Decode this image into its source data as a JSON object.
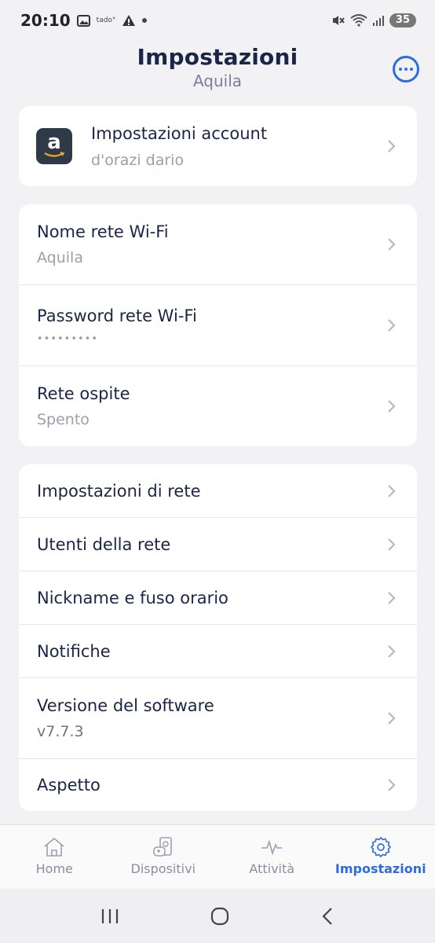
{
  "status_bar": {
    "time": "20:10",
    "small_icon_text": "tado°",
    "battery": "35"
  },
  "header": {
    "title": "Impostazioni",
    "subtitle": "Aquila"
  },
  "account": {
    "label": "Impostazioni account",
    "value": "d'orazi dario",
    "logo_letter": "a"
  },
  "wifi_section": [
    {
      "label": "Nome rete Wi-Fi",
      "value": "Aquila"
    },
    {
      "label": "Password rete Wi-Fi",
      "value": "•••••••••"
    },
    {
      "label": "Rete ospite",
      "value": "Spento"
    }
  ],
  "settings_section": [
    {
      "label": "Impostazioni di rete"
    },
    {
      "label": "Utenti della rete"
    },
    {
      "label": "Nickname e fuso orario"
    },
    {
      "label": "Notifiche"
    },
    {
      "label": "Versione del software",
      "value": "v7.7.3"
    },
    {
      "label": "Aspetto"
    }
  ],
  "bottom_nav": [
    {
      "label": "Home",
      "icon": "home-icon"
    },
    {
      "label": "Dispositivi",
      "icon": "devices-icon"
    },
    {
      "label": "Attività",
      "icon": "activity-icon"
    },
    {
      "label": "Impostazioni",
      "icon": "gear-icon",
      "active": true
    }
  ],
  "colors": {
    "accent": "#2d6de0",
    "primary_text": "#1b2547",
    "secondary_text": "#9a9fac",
    "background": "#f2f2f4"
  }
}
